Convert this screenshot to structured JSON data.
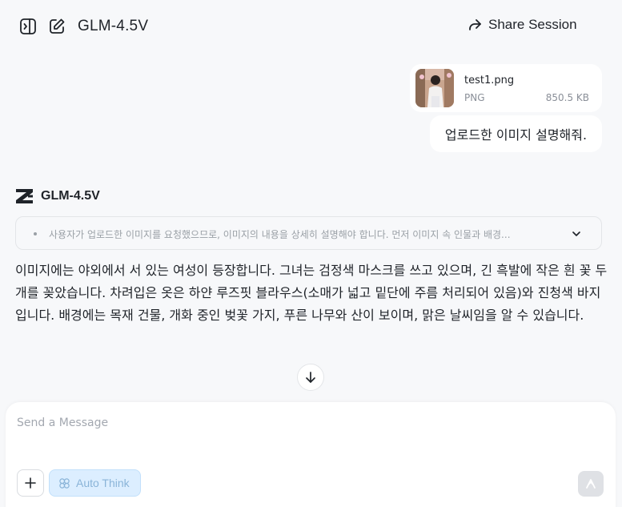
{
  "header": {
    "title": "GLM-4.5V",
    "share_label": "Share Session"
  },
  "attachment": {
    "file_name": "test1.png",
    "file_type": "PNG",
    "file_size": "850.5 KB"
  },
  "user_message": "업로드한 이미지 설명해줘.",
  "assistant": {
    "model_name": "GLM-4.5V",
    "thinking_preview": "사용자가 업로드한 이미지를 요청했으므로, 이미지의 내용을 상세히 설명해야 합니다. 먼저 이미지 속 인물과 배경...",
    "answer": "이미지에는 야외에서 서 있는 여성이 등장합니다. 그녀는 검정색 마스크를 쓰고 있으며, 긴 흑발에 작은 흰 꽃 두 개를 꽂았습니다. 차려입은 옷은 하얀 루즈핏 블라우스(소매가 넓고 밑단에 주름 처리되어 있음)와 진청색 바지입니다. 배경에는 목재 건물, 개화 중인 벚꽃 가지, 푸른 나무와 산이 보이며, 맑은 날씨임을 알 수 있습니다."
  },
  "composer": {
    "placeholder": "Send a Message",
    "auto_think_label": "Auto Think"
  },
  "icons": {
    "sidebar_toggle": "sidebar-toggle-icon",
    "new_chat": "edit-icon",
    "share": "share-arrow-icon",
    "chevron": "chevron-down-icon",
    "scroll_down": "arrow-down-icon",
    "plus": "plus-icon",
    "auto_think": "flower-icon",
    "send": "send-arrow-icon",
    "logo": "z-logo-icon"
  }
}
